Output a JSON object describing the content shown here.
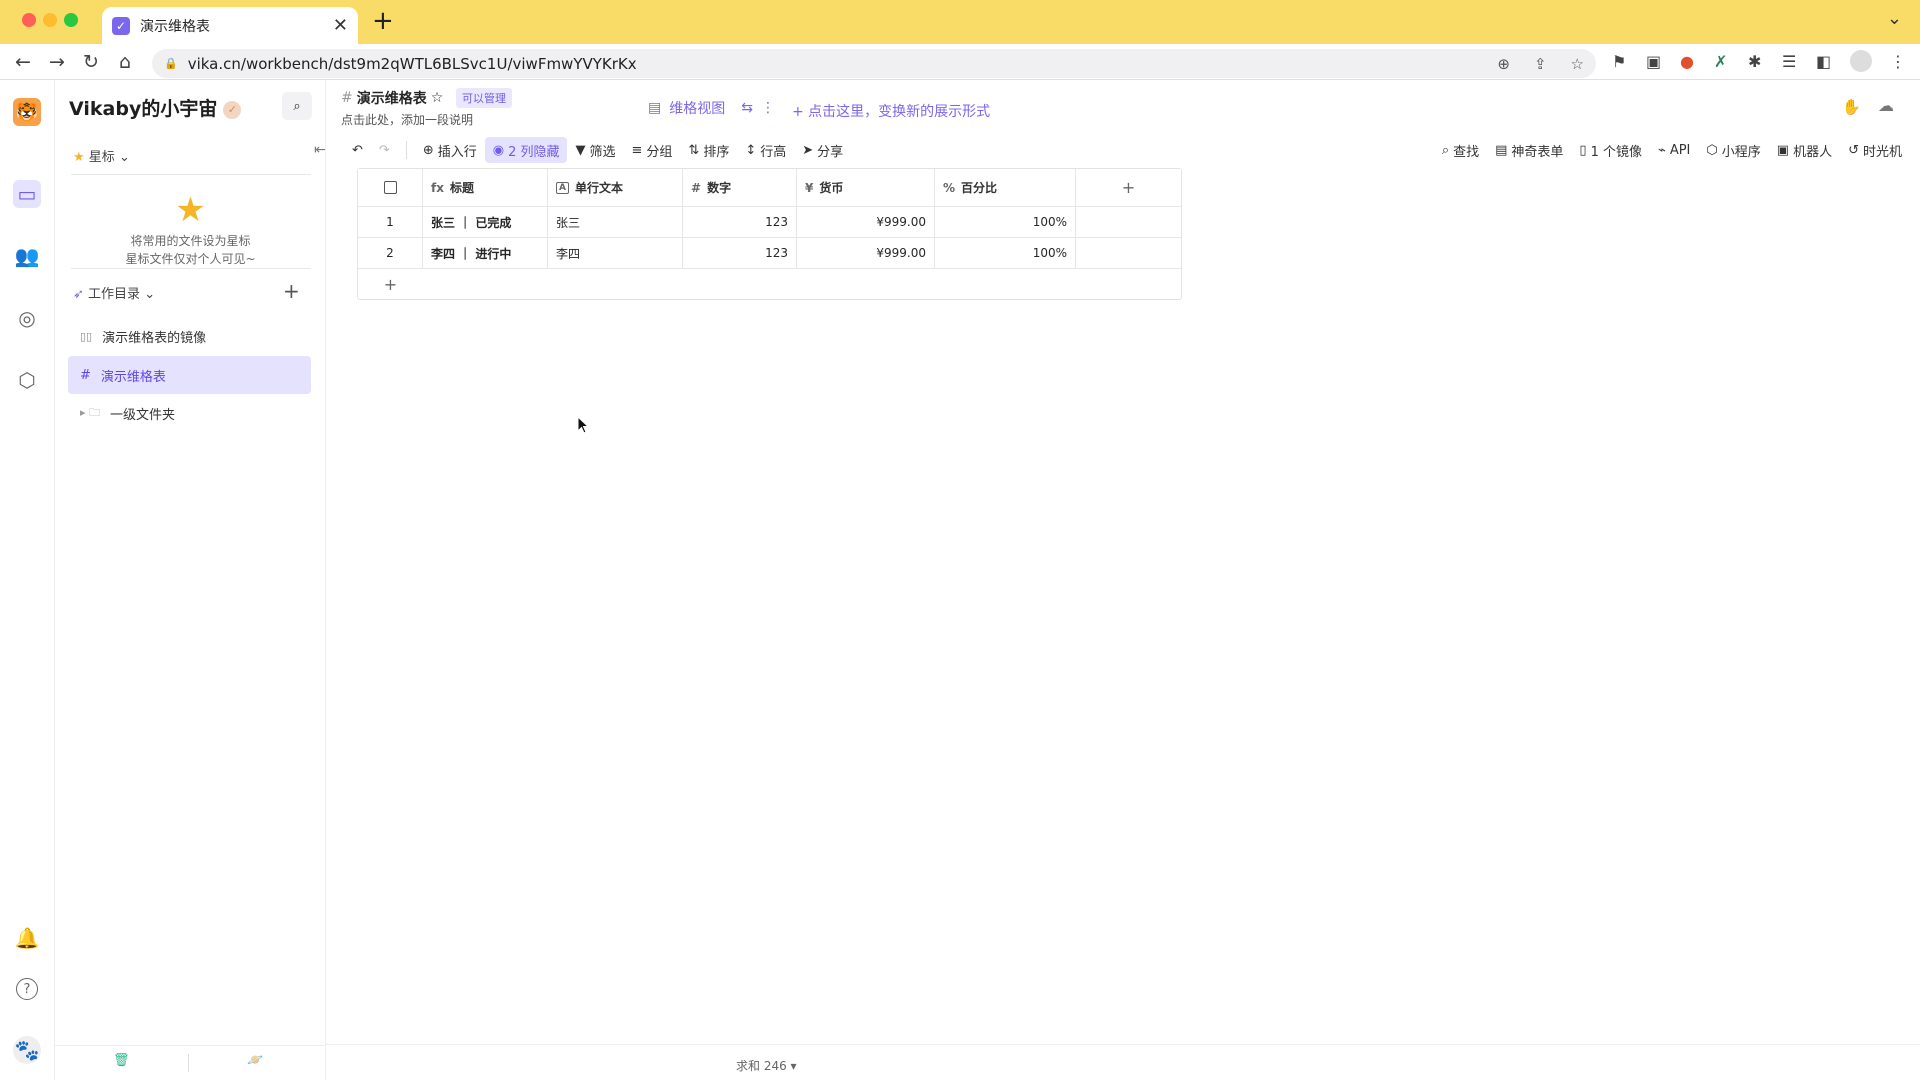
{
  "browser": {
    "tab_title": "演示维格表",
    "url": "vika.cn/workbench/dst9m2qWTL6BLSvc1U/viwFmwYVYKrKx",
    "new_tab": "+",
    "tab_close": "✕",
    "tab_menu": "⌄",
    "back": "←",
    "forward": "→",
    "reload": "↻",
    "home": "⌂",
    "lock": "🔒",
    "zoom": "⊕",
    "share": "⇪",
    "bookmark": "☆"
  },
  "rail": {
    "logo": "🐯",
    "workbench_icon": "▭",
    "members_icon": "👥",
    "explore_icon": "◎",
    "settings_icon": "⬡",
    "bell_icon": "🔔",
    "help_icon": "?",
    "avatar_icon": "🐾"
  },
  "sidebar": {
    "workspace_name": "Vikaby的小宇宙",
    "workspace_badge": "✓",
    "star_label": "星标",
    "star_empty_line1": "将常用的文件设为星标",
    "star_empty_line2": "星标文件仅对个人可见~",
    "workdir_label": "工作目录",
    "add": "+",
    "nodes": [
      {
        "icon": "▯▯",
        "label": "演示维格表的镜像"
      },
      {
        "icon": "#",
        "label": "演示维格表"
      },
      {
        "icon": "▸ 🗀",
        "label": "一级文件夹"
      }
    ],
    "trash_icon": "🗑",
    "planet_icon": "🪐"
  },
  "header": {
    "title": "演示维格表",
    "title_icon": "#",
    "star_icon": "☆",
    "permission": "可以管理",
    "description": "点击此处，添加一段说明",
    "view_name": "维格视图",
    "view_icon": "▤",
    "view_switch_icon": "⇆",
    "view_more_icon": "⋮",
    "add_view": "+ 点击这里，变换新的展示形式"
  },
  "view_toolbar": {
    "undo": "↶",
    "redo": "↷",
    "insert_row": "插入行",
    "hidden_columns": "2 列隐藏",
    "filter": "筛选",
    "group": "分组",
    "sort": "排序",
    "row_height": "行高",
    "share": "分享",
    "search": "查找",
    "form": "神奇表单",
    "mirror": "1 个镜像",
    "api": "API",
    "widget": "小程序",
    "robot": "机器人",
    "time_machine": "时光机"
  },
  "grid": {
    "columns": [
      {
        "icon": "fx",
        "name": "标题"
      },
      {
        "icon": "A",
        "name": "单行文本"
      },
      {
        "icon": "#",
        "name": "数字"
      },
      {
        "icon": "¥",
        "name": "货币"
      },
      {
        "icon": "%",
        "name": "百分比"
      }
    ],
    "add_column": "+",
    "add_row": "+",
    "rows": [
      {
        "index": "1",
        "title": "张三 ｜ 已完成",
        "text": "张三",
        "number": "123",
        "currency": "¥999.00",
        "percent": "100%"
      },
      {
        "index": "2",
        "title": "李四 ｜ 进行中",
        "text": "李四",
        "number": "123",
        "currency": "¥999.00",
        "percent": "100%"
      }
    ]
  },
  "footer": {
    "sum": "求和 246 ▾"
  },
  "colors": {
    "brand": "#7b67ee",
    "chrome_tab_bar": "#f9dc67",
    "active_bg": "#e5e2fd"
  }
}
